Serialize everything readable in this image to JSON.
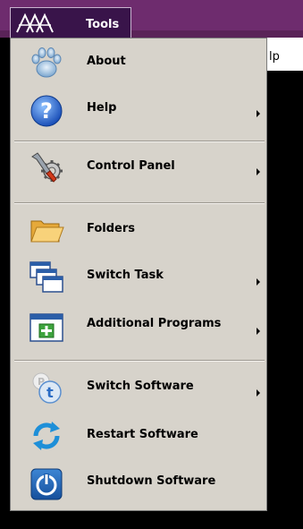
{
  "topbar": {
    "menu_label": "Tools",
    "logo_icon": "avolites-logo",
    "accent_color": "#6e2c6e"
  },
  "background": {
    "partial_menu_text": "lp"
  },
  "menu": {
    "items": [
      {
        "label": "About",
        "icon": "paw-icon",
        "has_submenu": false
      },
      {
        "label": "Help",
        "icon": "question-icon",
        "has_submenu": true
      },
      {
        "label": "Control Panel",
        "icon": "wrench-gear-icon",
        "has_submenu": true
      },
      {
        "label": "Folders",
        "icon": "folder-icon",
        "has_submenu": false
      },
      {
        "label": "Switch Task",
        "icon": "windows-icon",
        "has_submenu": true
      },
      {
        "label": "Additional Programs",
        "icon": "add-window-icon",
        "has_submenu": true
      },
      {
        "label": "Switch Software",
        "icon": "switch-software-icon",
        "has_submenu": true
      },
      {
        "label": "Restart Software",
        "icon": "restart-icon",
        "has_submenu": false
      },
      {
        "label": "Shutdown Software",
        "icon": "power-icon",
        "has_submenu": false
      }
    ]
  }
}
